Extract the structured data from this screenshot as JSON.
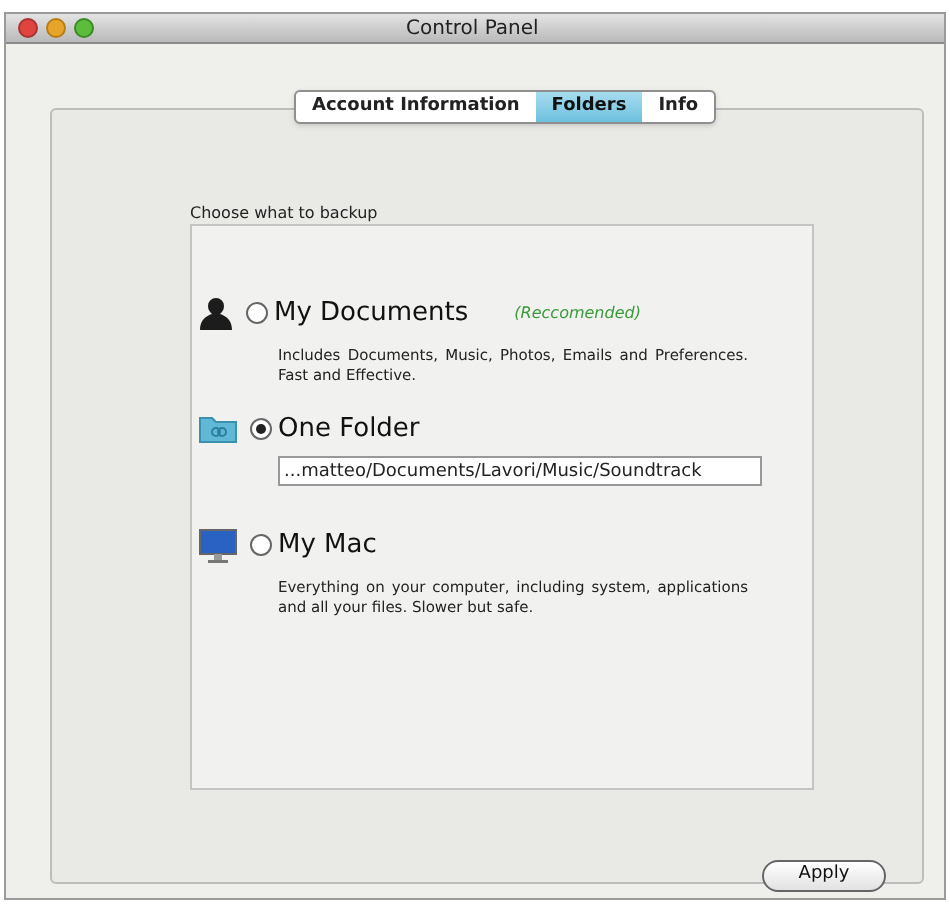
{
  "window": {
    "title": "Control Panel"
  },
  "tabs": [
    {
      "label": "Account Information",
      "selected": false
    },
    {
      "label": "Folders",
      "selected": true
    },
    {
      "label": "Info",
      "selected": false
    }
  ],
  "group": {
    "title": "Choose what to backup"
  },
  "options": [
    {
      "kind": "documents",
      "label": "My Documents",
      "selected": false,
      "note": "(Reccomended)",
      "description": "Includes Documents, Music, Photos, Emails and Preferences. Fast and Effective."
    },
    {
      "kind": "folder",
      "label": "One Folder",
      "selected": true,
      "path": "...matteo/Documents/Lavori/Music/Soundtrack"
    },
    {
      "kind": "mac",
      "label": "My Mac",
      "selected": false,
      "description": "Everything on your computer, including system, applications and all your files. Slower but safe."
    }
  ],
  "buttons": [
    {
      "label": "Apply"
    }
  ]
}
